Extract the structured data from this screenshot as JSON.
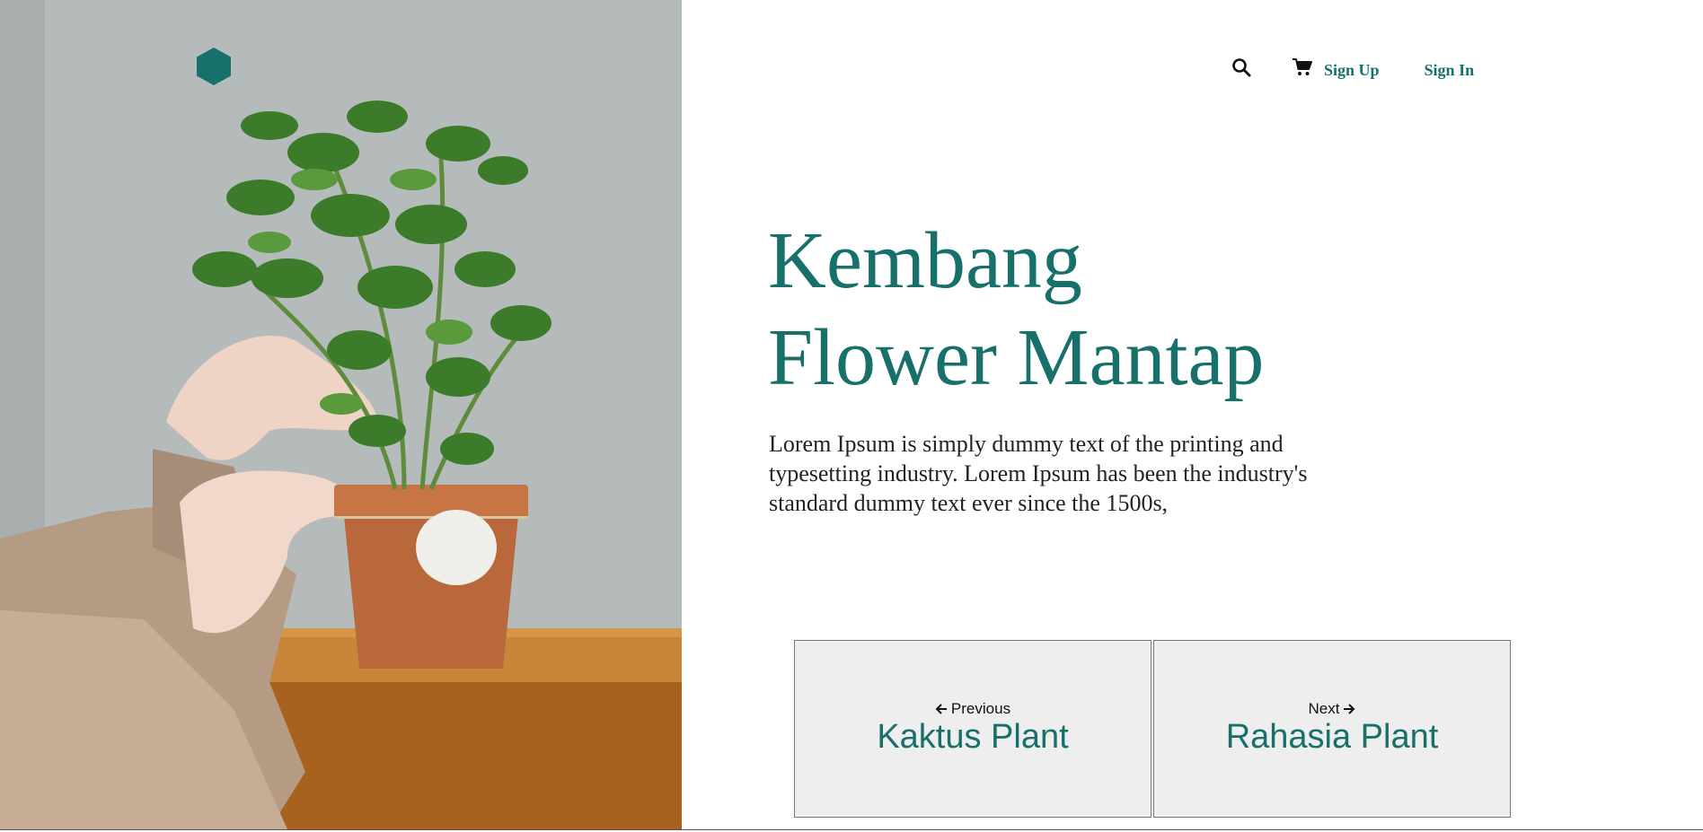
{
  "nav": {
    "search_icon": "search-icon",
    "cart_icon": "cart-icon",
    "signup_label": "Sign Up",
    "signin_label": "Sign In"
  },
  "logo": {
    "shape": "hexagon",
    "color": "#17706a"
  },
  "hero": {
    "title_line1": "Kembang",
    "title_line2": "Flower Mantap",
    "description": "Lorem Ipsum is simply dummy text of the printing and typesetting industry. Lorem Ipsum has been the industry's standard dummy text ever since the 1500s,"
  },
  "pager": {
    "prev": {
      "direction_label": "Previous",
      "title": "Kaktus Plant"
    },
    "next": {
      "direction_label": "Next",
      "title": "Rahasia Plant"
    }
  },
  "colors": {
    "accent": "#17706a",
    "card_bg": "#eeeeee",
    "text": "#222222"
  }
}
